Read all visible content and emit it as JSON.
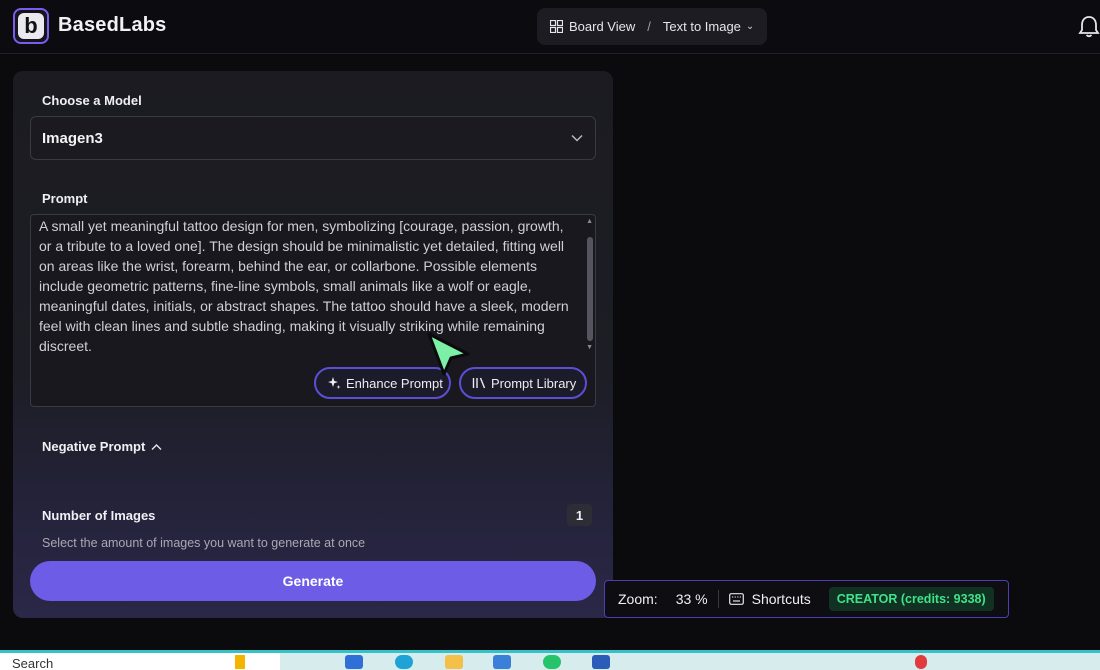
{
  "header": {
    "brand": "BasedLabs",
    "logo_letter": "b",
    "breadcrumb_view": "Board View",
    "breadcrumb_sep": "/",
    "breadcrumb_current": "Text to Image"
  },
  "panel": {
    "model_label": "Choose a Model",
    "model_value": "Imagen3",
    "prompt_label": "Prompt",
    "prompt_text": "A small yet meaningful tattoo design for men, symbolizing [courage, passion, growth, or a tribute to a loved one]. The design should be minimalistic yet detailed, fitting well on areas like the wrist, forearm, behind the ear, or collarbone. Possible elements include geometric patterns, fine-line symbols, small animals like a wolf or eagle, meaningful dates, initials, or abstract shapes. The tattoo should have a sleek, modern feel with clean lines and subtle shading, making it visually striking while remaining discreet.",
    "enhance_label": "Enhance Prompt",
    "library_label": "Prompt Library",
    "negative_label": "Negative Prompt",
    "num_images_label": "Number of Images",
    "num_images_value": "1",
    "num_images_hint": "Select the amount of images you want to generate at once",
    "generate_label": "Generate"
  },
  "zoombar": {
    "zoom_label": "Zoom:",
    "zoom_value": "33 %",
    "shortcuts_label": "Shortcuts",
    "plan_badge": "CREATOR (credits: 9338)"
  },
  "taskbar": {
    "search_text": "Search"
  },
  "colors": {
    "accent": "#6d5ce6",
    "plan_green": "#3ee38a",
    "cursor_green": "#7df0a8"
  }
}
